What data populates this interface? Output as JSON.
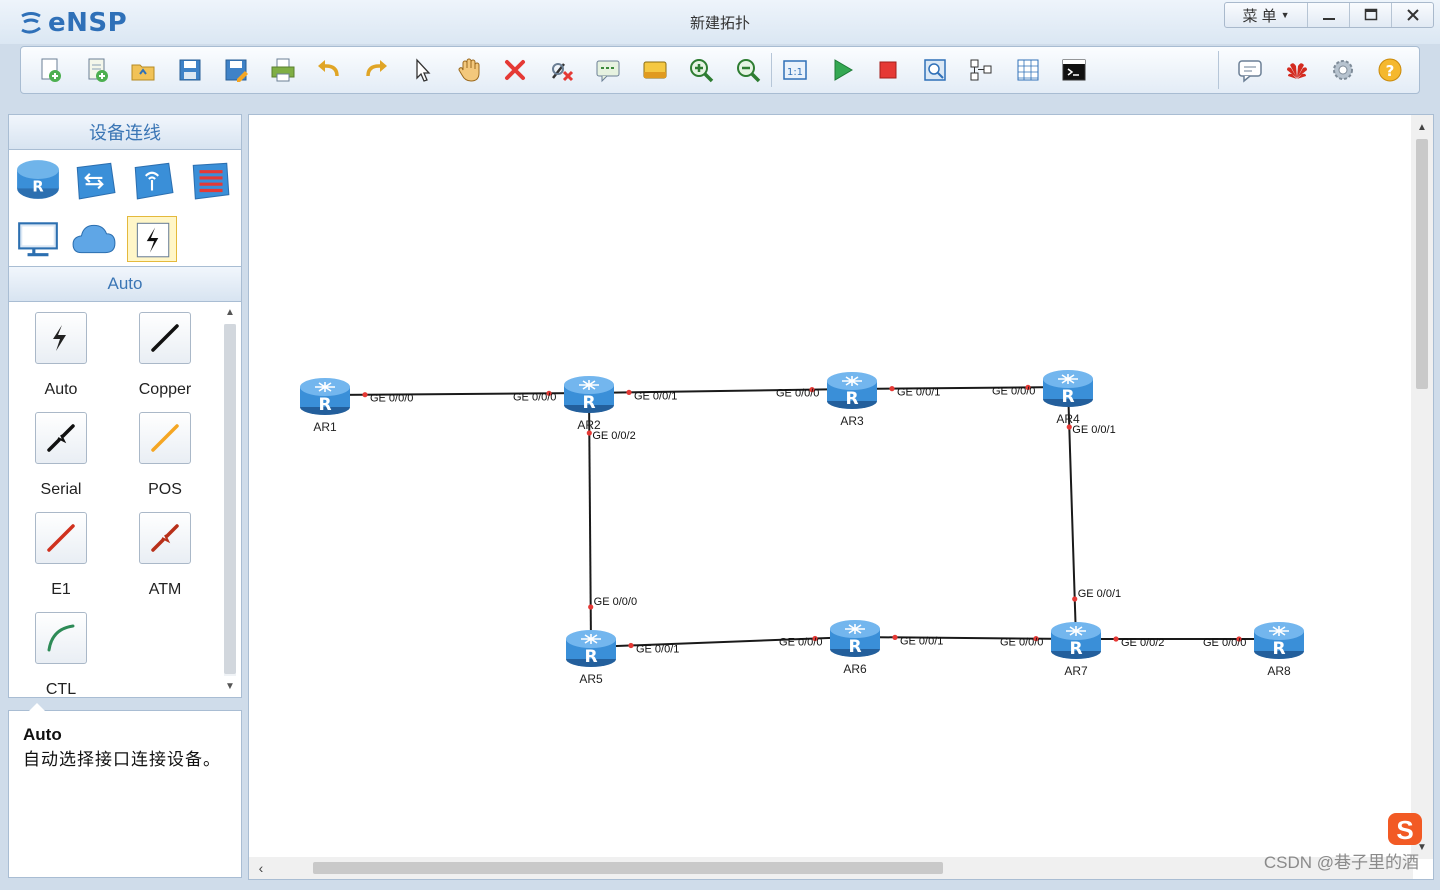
{
  "app": {
    "logo_text": "eNSP",
    "window_title": "新建拓扑",
    "menu_label": "菜 单",
    "minimize": "—",
    "maximize": "□",
    "close": "✕"
  },
  "toolbar": {
    "buttons": [
      {
        "name": "new-topology-icon"
      },
      {
        "name": "new-lab-icon"
      },
      {
        "name": "open-icon"
      },
      {
        "name": "save-icon"
      },
      {
        "name": "save-as-icon"
      },
      {
        "name": "print-icon"
      },
      {
        "name": "undo-icon"
      },
      {
        "name": "redo-icon"
      },
      {
        "name": "select-pointer-icon"
      },
      {
        "name": "pan-hand-icon"
      },
      {
        "name": "delete-icon"
      },
      {
        "name": "delete-link-icon"
      },
      {
        "name": "text-note-icon"
      },
      {
        "name": "palette-icon"
      },
      {
        "name": "zoom-in-icon"
      },
      {
        "name": "zoom-out-icon"
      },
      {
        "name": "fit-view-icon"
      },
      {
        "name": "start-device-icon"
      },
      {
        "name": "stop-device-icon"
      },
      {
        "name": "capture-icon"
      },
      {
        "name": "topology-icon"
      },
      {
        "name": "grid-icon"
      },
      {
        "name": "console-icon"
      }
    ],
    "right_buttons": [
      {
        "name": "chat-icon"
      },
      {
        "name": "huawei-logo-icon"
      },
      {
        "name": "settings-gear-icon"
      },
      {
        "name": "help-icon"
      }
    ]
  },
  "left_panel": {
    "header": "设备连线",
    "device_categories": [
      {
        "name": "router-category-icon"
      },
      {
        "name": "switch-category-icon"
      },
      {
        "name": "wireless-category-icon"
      },
      {
        "name": "firewall-category-icon"
      },
      {
        "name": "terminal-category-icon"
      },
      {
        "name": "cloud-category-icon"
      },
      {
        "name": "cable-category-icon"
      }
    ],
    "sub_header": "Auto",
    "cables": [
      {
        "label": "Auto",
        "color": "#222222",
        "kind": "auto"
      },
      {
        "label": "Copper",
        "color": "#111111",
        "kind": "line"
      },
      {
        "label": "Serial",
        "color": "#111111",
        "kind": "serial"
      },
      {
        "label": "POS",
        "color": "#f5a623",
        "kind": "line"
      },
      {
        "label": "E1",
        "color": "#d0311e",
        "kind": "line"
      },
      {
        "label": "ATM",
        "color": "#b8301a",
        "kind": "serial"
      },
      {
        "label": "CTL",
        "color": "#2e8b57",
        "kind": "curve"
      }
    ],
    "description": {
      "title": "Auto",
      "text": "自动选择接口连接设备。"
    }
  },
  "topology": {
    "routers": [
      {
        "id": "AR1",
        "label": "AR1"
      },
      {
        "id": "AR2",
        "label": "AR2"
      },
      {
        "id": "AR3",
        "label": "AR3"
      },
      {
        "id": "AR4",
        "label": "AR4"
      },
      {
        "id": "AR5",
        "label": "AR5"
      },
      {
        "id": "AR6",
        "label": "AR6"
      },
      {
        "id": "AR7",
        "label": "AR7"
      },
      {
        "id": "AR8",
        "label": "AR8"
      }
    ],
    "links": [
      {
        "from": "AR1",
        "to": "AR2",
        "from_port": "GE 0/0/0",
        "to_port": "GE 0/0/0"
      },
      {
        "from": "AR2",
        "to": "AR3",
        "from_port": "GE 0/0/1",
        "to_port": "GE 0/0/0"
      },
      {
        "from": "AR3",
        "to": "AR4",
        "from_port": "GE 0/0/1",
        "to_port": "GE 0/0/0"
      },
      {
        "from": "AR2",
        "to": "AR5",
        "from_port": "GE 0/0/2",
        "to_port": "GE 0/0/0"
      },
      {
        "from": "AR4",
        "to": "AR7",
        "from_port": "GE 0/0/1",
        "to_port": "GE 0/0/1"
      },
      {
        "from": "AR5",
        "to": "AR6",
        "from_port": "GE 0/0/1",
        "to_port": "GE 0/0/0"
      },
      {
        "from": "AR6",
        "to": "AR7",
        "from_port": "GE 0/0/1",
        "to_port": "GE 0/0/0"
      },
      {
        "from": "AR7",
        "to": "AR8",
        "from_port": "GE 0/0/2",
        "to_port": "GE 0/0/0"
      }
    ],
    "link_color": "#1a1a1a",
    "port_dot_color": "#e53935",
    "router_color": "#3a8fd8"
  },
  "watermark": "CSDN @巷子里的酒"
}
